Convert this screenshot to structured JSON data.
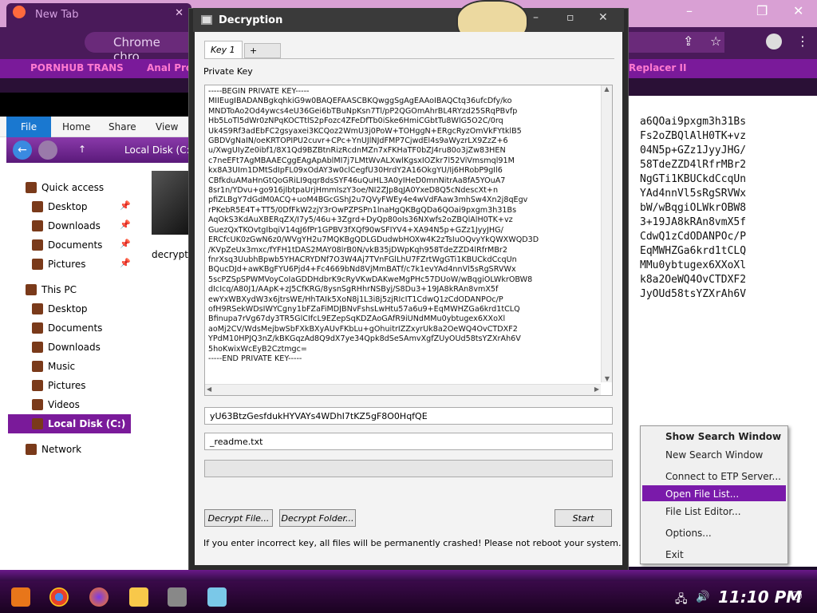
{
  "chrome": {
    "tab_title": "New Tab",
    "omnibox": "Chrome chro",
    "bookmarks": [
      "PORNHUB TRANS",
      "Anal Prol",
      "Replacer II"
    ]
  },
  "explorer": {
    "ribbon": [
      "File",
      "Home",
      "Share",
      "View"
    ],
    "address": "Local Disk (C:)",
    "nav": [
      {
        "label": "Quick access",
        "pin": false
      },
      {
        "label": "Desktop",
        "pin": true
      },
      {
        "label": "Downloads",
        "pin": true
      },
      {
        "label": "Documents",
        "pin": true
      },
      {
        "label": "Pictures",
        "pin": true
      },
      {
        "label": "This PC",
        "pin": false
      },
      {
        "label": "Desktop",
        "pin": false
      },
      {
        "label": "Documents",
        "pin": false
      },
      {
        "label": "Downloads",
        "pin": false
      },
      {
        "label": "Music",
        "pin": false
      },
      {
        "label": "Pictures",
        "pin": false
      },
      {
        "label": "Videos",
        "pin": false
      },
      {
        "label": "Local Disk (C:)",
        "pin": false
      },
      {
        "label": "Network",
        "pin": false
      }
    ],
    "file_label": "decrypt_y"
  },
  "bg_text": "a6QOai9pxgm3h31Bs\nFs2oZBQlAlH0TK+vz\n04N5p+GZz1JyyJHG/\n58TdeZZD4lRfrMBr2\nNgGTi1KBUCkdCcqUn\nYAd4nnVl5sRgSRVWx\nbW/wBqgiOLWkrOBW8\n3+19JA8kRAn8vmX5f\nCdwQ1zCdODANPOc/P\nEqMWHZGa6krd1tCLQ\nMMu0ybtugex6XXoXl\nk8a2OeWQ4OvCTDXF2\nJyOUd58tsYZXrAh6V",
  "dialog": {
    "title": "Decryption",
    "tabs": [
      "Key 1",
      "+"
    ],
    "private_key_label": "Private Key",
    "key_text": "-----BEGIN PRIVATE KEY-----\nMIIEugIBADANBgkqhkiG9w0BAQEFAASCBKQwggSgAgEAAoIBAQCtq36ufcDfy/ko\nMNDToAo2Od4ywcs4eU36Gei6bTBuNpKsn7Tl/pP2QGOmAhrBL4RYzd25SRqPBvfp\nHb5LoTl5dWr0zNPqKOCTtlS2pFozc4ZFeDfTb0iSke6HmiCGbtTu8WlG5O2C/0rq\nUk4S9Rf3adEbFC2gsyaxei3KCQoz2WmU3j0PoW+TOHggN+ERgcRyzOmVkFYtklB5\nGBDVgNaIN/oeKRTOPIPU2cuvr+CPc+YnUJlNJdFMP7CjwdEl4s9aWyzrLX9ZzZ+6\nu/XwgUIyZe0ibf1/8X1Qd9BZBtnRizRcdnMZn7xFKHaTF0bZJ4ru80o3jZw83HEN\nc7neEFt7AgMBAAECggEAgApAblMI7j7LMtWvALXwlKgsxIOZkr7l52ViVmsmql91M\nkx8A3UIm1DMtSdIpFL09xOdAY3w0clCegfU30HrdY2A16OkgYU/Ij6HRobP9gIl6\nCBfkduAMaHnGtQoGRiLI9qqr8dsSYF46uQuHL3A0yIHeD0mnNitrAa8fA5YOuA7\n8sr1n/YDvu+go916jIbtpaUrjHmmIszY3oe/NI2ZJp8qJA0YxeD8Q5cNdescXt+n\npfiZLBgY7dGdM0ACQ+uoM4BGcGShJ2u7QVyFWEy4e4wVdFAaw3mhSw4Xn2j8qEgv\nrPKebR5E4T+TT5/0DfFkW2zjY3rOwPZPSPn1lnaHgQKBgQDa6QOai9pxgm3h31Bs\nAqOkS3KdAuXBERqZX/I7y5/46u+3Zgrd+DyQp80oIs36NXwfs2oZBQlAlH0TK+vz\nGuezQxTKOvtgIbqiV14qJ6fPr1GPBV3fXQf90wSFIYV4+XA94N5p+GZz1JyyJHG/\nERCfcUK0zGwN6z0/WVgYH2u7MQKBgQDLGDudwbHOXw4K2zTsIuOQvyYkQWXWQD3D\n/KVpZeUx3mxc/fYFH1tDAS2MAY08lrB0N/vkB35jDWpKqh958TdeZZD4lRfrMBr2\nfnrXsq3UubhBpwb5YHACRYDNf7O3W4Aj7TVnFGlLhU7FZrtWgGTi1KBUCkdCcqUn\nBQucDJd+awKBgFYU6Pjd4+Fc4669bNd8VjMmBATf/c7k1evYAd4nnVl5sRgSRVWx\n5scPZSpSPWMVoyCoIaGDDHdbrK9cRyVKwDAKweMgPHc57DUoW/wBqgiOLWkrOBW8\ndIcIcq/A80J1/AApK+zJ5CfKRG/8ysnSgRHhrNSByj/S8Du3+19JA8kRAn8vmX5f\newYxWBXydW3x6jtrsWE/HhTAIk5XoN8j1L3i8j5zjRIcIT1CdwQ1zCdODANPOc/P\nofH9RSekWDsIWYCgny1bFZaFiMDJBNvFshsLwHtu57a6u9+EqMWHZGa6krd1tCLQ\nBfinupa7rVg67dy3TR5GlCIfcL9EZepSqKDZAoGAfR9iUNdMMu0ybtugex6XXoXl\naoMj2CV/WdsMejbwSbFXkBXyAUvFKbLu+gOhuitrIZZxyrUk8a2OeWQ4OvCTDXF2\nYPdM10HPJQ3nZ/kBKGqzAd8Q9dX7ye34Qpk8dSeSAmvXgfZUyOUd58tsYZXrAh6V\n5hoKwixWcEyB2Cztmgc=\n-----END PRIVATE KEY-----",
    "key_field": "yU63BtzGesfdukHYVAYs4WDhI7tKZ5gF8O0HqfQE",
    "readme_field": "_readme.txt",
    "buttons": {
      "decrypt_file": "Decrypt File...",
      "decrypt_folder": "Decrypt Folder...",
      "start": "Start"
    },
    "warning": "If you enter incorrect key, all files will be permanently crashed! Please not reboot your system."
  },
  "menu": {
    "items": [
      "Show Search Window",
      "New Search Window",
      "Connect to ETP Server...",
      "Open File List...",
      "File List Editor...",
      "Options...",
      "Exit"
    ],
    "highlighted": "Open File List..."
  },
  "taskbar": {
    "clock": "11:10 PM"
  }
}
